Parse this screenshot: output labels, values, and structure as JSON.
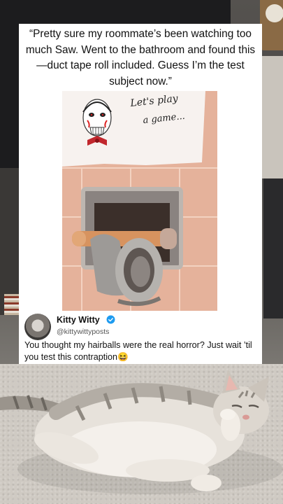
{
  "post": {
    "quote": "“Pretty sure my roommate’s been watching too much Saw. Went to the bathroom and found this—duct tape roll included. Guess I’m the test subject now.”",
    "sign_text_line1": "Let's play",
    "sign_text_line2": "a game..."
  },
  "author": {
    "name": "Kitty Witty",
    "handle": "@kittywittyposts",
    "verified": true,
    "avatar_icon": "cat-avatar-icon"
  },
  "reply": {
    "text": "You thought my hairballs were the real horror? Just wait ’til you test this contraption😆"
  },
  "colors": {
    "verified_blue": "#1d9bf0",
    "tile": "#e9b9a3",
    "card": "#ffffff"
  }
}
